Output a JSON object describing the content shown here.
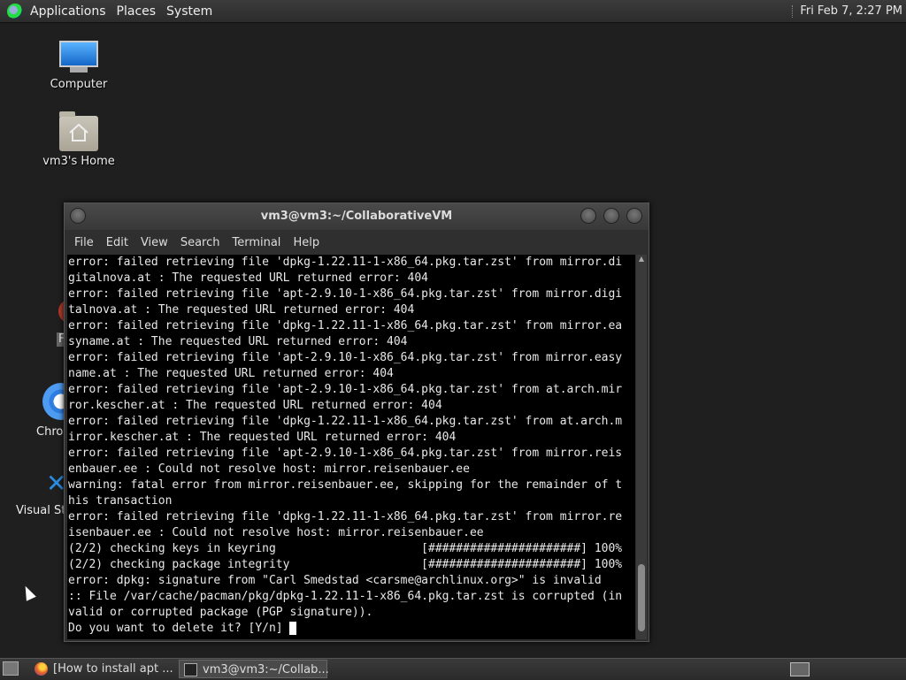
{
  "top_panel": {
    "menus": [
      "Applications",
      "Places",
      "System"
    ],
    "clock": "Fri Feb  7,  2:27 PM"
  },
  "desktop": {
    "icons": [
      {
        "label": "Computer",
        "icon": "computer-icon"
      },
      {
        "label": "vm3's Home",
        "icon": "home-folder-icon"
      }
    ],
    "partial_labels": [
      "F",
      "Chron",
      "Visual Stu"
    ]
  },
  "terminal": {
    "title": "vm3@vm3:~/CollaborativeVM",
    "menu": [
      "File",
      "Edit",
      "View",
      "Search",
      "Terminal",
      "Help"
    ],
    "lines": [
      "error: failed retrieving file 'dpkg-1.22.11-1-x86_64.pkg.tar.zst' from mirror.di",
      "gitalnova.at : The requested URL returned error: 404",
      "error: failed retrieving file 'apt-2.9.10-1-x86_64.pkg.tar.zst' from mirror.digi",
      "talnova.at : The requested URL returned error: 404",
      "error: failed retrieving file 'dpkg-1.22.11-1-x86_64.pkg.tar.zst' from mirror.ea",
      "syname.at : The requested URL returned error: 404",
      "error: failed retrieving file 'apt-2.9.10-1-x86_64.pkg.tar.zst' from mirror.easy",
      "name.at : The requested URL returned error: 404",
      "error: failed retrieving file 'apt-2.9.10-1-x86_64.pkg.tar.zst' from at.arch.mir",
      "ror.kescher.at : The requested URL returned error: 404",
      "error: failed retrieving file 'dpkg-1.22.11-1-x86_64.pkg.tar.zst' from at.arch.m",
      "irror.kescher.at : The requested URL returned error: 404",
      "error: failed retrieving file 'apt-2.9.10-1-x86_64.pkg.tar.zst' from mirror.reis",
      "enbauer.ee : Could not resolve host: mirror.reisenbauer.ee",
      "warning: fatal error from mirror.reisenbauer.ee, skipping for the remainder of t",
      "his transaction",
      "error: failed retrieving file 'dpkg-1.22.11-1-x86_64.pkg.tar.zst' from mirror.re",
      "isenbauer.ee : Could not resolve host: mirror.reisenbauer.ee",
      "(2/2) checking keys in keyring                     [######################] 100%",
      "(2/2) checking package integrity                   [######################] 100%",
      "error: dpkg: signature from \"Carl Smedstad <carsme@archlinux.org>\" is invalid",
      ":: File /var/cache/pacman/pkg/dpkg-1.22.11-1-x86_64.pkg.tar.zst is corrupted (in",
      "valid or corrupted package (PGP signature)).",
      "Do you want to delete it? [Y/n] "
    ]
  },
  "taskbar": {
    "tasks": [
      {
        "label": "[How to install apt ...",
        "icon": "firefox-icon"
      },
      {
        "label": "vm3@vm3:~/Collab...",
        "icon": "terminal-icon"
      }
    ]
  }
}
